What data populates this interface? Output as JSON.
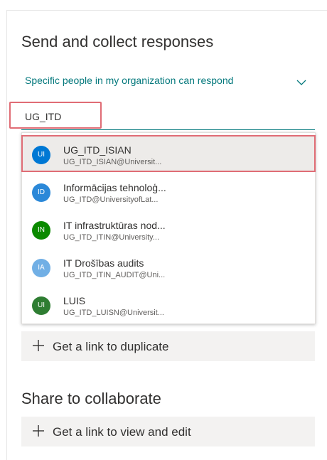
{
  "send": {
    "title": "Send and collect responses",
    "responder_scope": "Specific people in my organization can respond",
    "search_value": "UG_ITD",
    "suggestions": [
      {
        "initials": "UI",
        "name": "UG_ITD_ISIAN",
        "email": "UG_ITD_ISIAN@Universit...",
        "avatar_color": "#0078d4"
      },
      {
        "initials": "ID",
        "name": "Informācijas tehnoloģ...",
        "email": "UG_ITD@UniversityofLat...",
        "avatar_color": "#2b88d8"
      },
      {
        "initials": "IN",
        "name": "IT infrastruktūras nod...",
        "email": "UG_ITD_ITIN@University...",
        "avatar_color": "#0b8a00"
      },
      {
        "initials": "IA",
        "name": "IT Drošības audits",
        "email": "UG_ITD_ITIN_AUDIT@Uni...",
        "avatar_color": "#71afe5"
      },
      {
        "initials": "UI",
        "name": "LUIS",
        "email": "UG_ITD_LUISN@Universit...",
        "avatar_color": "#2e7d32"
      }
    ],
    "duplicate_label": "Get a link to duplicate"
  },
  "share": {
    "title": "Share to collaborate",
    "view_edit_label": "Get a link to view and edit"
  },
  "icons": {
    "dropdown": "chevron-down-icon",
    "add": "plus-icon"
  },
  "colors": {
    "accent": "#03787c",
    "highlight": "#e06c75"
  }
}
